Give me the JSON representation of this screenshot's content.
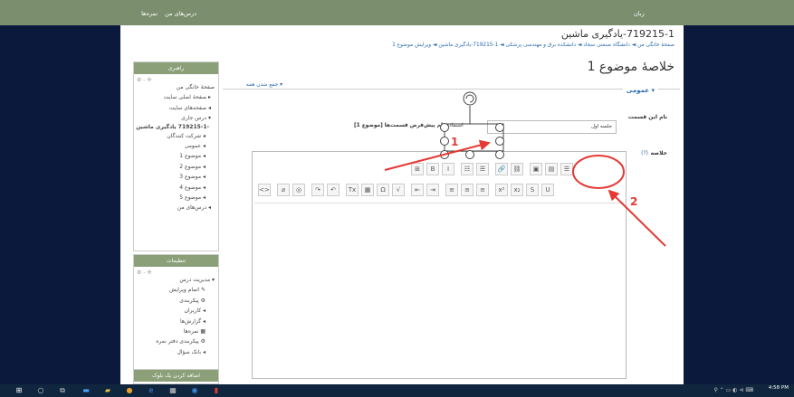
{
  "topbar": {
    "lang": "زبان",
    "grades": "نمره‌ها",
    "my_courses": "درس‌های من"
  },
  "course_title": "719215-1-یادگیری ماشین",
  "breadcrumb": "صفحهٔ خانگی من ◄ دانشگاه صنعتی سجاد ◄ دانشکده برق و مهندسی پزشکی ◄ 1-719215-یادگیری ماشین ◄ ویرایش موضوع 1",
  "page_heading": "خلاصهٔ موضوع 1",
  "collapse_all": "▾ جمع شدن همه",
  "nav_block": {
    "title": "راهبری",
    "tools": "⚙ - ✣",
    "items": [
      "صفحهٔ خانگی من",
      "▸ صفحهٔ اصلی سایت",
      "◂ صفحه‌های سایت",
      "▾ درس جاری",
      "-719215-1 یادگیری ماشین",
      "◂ شرکت کنندگان",
      "◂ عمومی",
      "◂ موضوع 1",
      "◂ موضوع 2",
      "◂ موضوع 3",
      "◂ موضوع 4",
      "◂ موضوع 5",
      "◂ درس‌های من"
    ]
  },
  "settings_block": {
    "title": "تنظیمات",
    "tools": "⚙ - ✣",
    "items": [
      "▾ مدیریت درس",
      "✎ اتمام ویرایش",
      "⚙ پیکربندی",
      "◂ کاربران",
      "◂ گزارش‌ها",
      "▦ نمره‌ها",
      "⚙ پیکربندی دفتر نمره",
      "◂ بانک سؤال"
    ]
  },
  "add_block": {
    "title": "اضافه کردن یک بلوک"
  },
  "form": {
    "legend": "▾ عمومی",
    "name_label": "نام این قسمت",
    "name_value": "جلسه اول",
    "use_default_label": "استفاده",
    "default_text": "نام پیش‌فرض قسمت‌ها [موضوع 1]",
    "summary_label": "خلاصه",
    "help_icon": "(?)"
  },
  "toolbar": {
    "row1": [
      "☰",
      "B",
      "I",
      "☷",
      "☰",
      "🔗",
      "⛓",
      "▣",
      "▤",
      "⊞"
    ],
    "row2": [
      "U",
      "S",
      "x₂",
      "x²",
      "≡",
      "≡",
      "≡",
      "⇥",
      "⇤",
      "√",
      "Ω",
      "▦",
      "Tx",
      "↶",
      "↷",
      "◎",
      "⌀",
      "<>"
    ]
  },
  "annotations": {
    "a1": "1",
    "a2": "2"
  },
  "taskbar": {
    "time": "4:58 PM"
  },
  "colors": {
    "topbar": "#7b8f6e",
    "block_header": "#8ba078",
    "annotation": "#e53935",
    "link": "#2a6ab0",
    "background": "#0b1a3c"
  }
}
